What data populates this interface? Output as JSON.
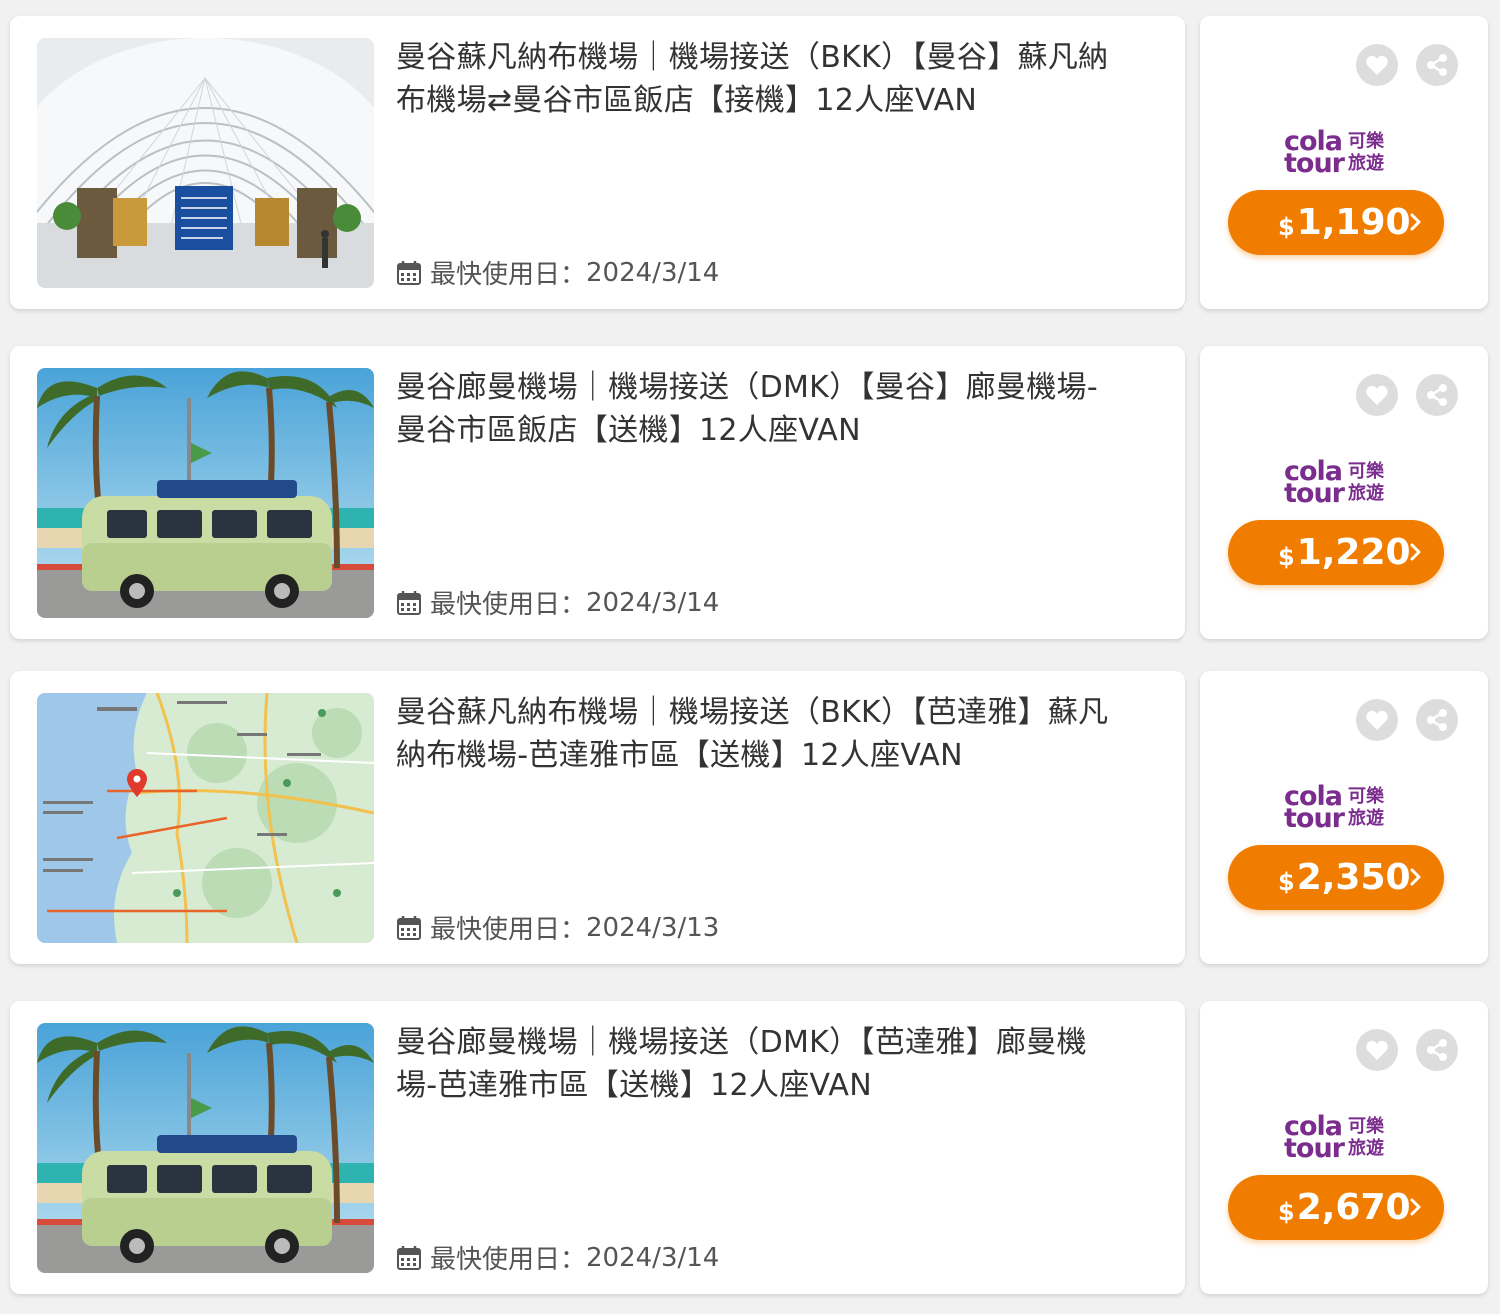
{
  "listings": [
    {
      "title": "曼谷蘇凡納布機場｜機場接送（BKK）【曼谷】蘇凡納布機場⇄曼谷市區飯店【接機】12人座VAN",
      "date_label": "最快使用日：",
      "date": "2024/3/14",
      "brand_en_1": "cola",
      "brand_en_2": "tour",
      "brand_zh_1": "可樂",
      "brand_zh_2": "旅遊",
      "currency": "$",
      "price": "1,190",
      "image_kind": "airport-terminal-photo"
    },
    {
      "title": "曼谷廊曼機場｜機場接送（DMK）【曼谷】廊曼機場-曼谷市區飯店【送機】12人座VAN",
      "date_label": "最快使用日：",
      "date": "2024/3/14",
      "brand_en_1": "cola",
      "brand_en_2": "tour",
      "brand_zh_1": "可樂",
      "brand_zh_2": "旅遊",
      "currency": "$",
      "price": "1,220",
      "image_kind": "beach-van-photo"
    },
    {
      "title": "曼谷蘇凡納布機場｜機場接送（BKK）【芭達雅】蘇凡納布機場-芭達雅市區【送機】12人座VAN",
      "date_label": "最快使用日：",
      "date": "2024/3/13",
      "brand_en_1": "cola",
      "brand_en_2": "tour",
      "brand_zh_1": "可樂",
      "brand_zh_2": "旅遊",
      "currency": "$",
      "price": "2,350",
      "image_kind": "pattaya-map-image"
    },
    {
      "title": "曼谷廊曼機場｜機場接送（DMK）【芭達雅】廊曼機場-芭達雅市區【送機】12人座VAN",
      "date_label": "最快使用日：",
      "date": "2024/3/14",
      "brand_en_1": "cola",
      "brand_en_2": "tour",
      "brand_zh_1": "可樂",
      "brand_zh_2": "旅遊",
      "currency": "$",
      "price": "2,670",
      "image_kind": "beach-van-photo"
    }
  ],
  "colors": {
    "accent_orange": "#f07d00",
    "brand_purple": "#7b2d8e",
    "icon_circle_gray": "#dddddd"
  },
  "icons": {
    "calendar": "calendar-icon",
    "favorite": "heart-icon",
    "share": "share-icon",
    "price_arrow": "chevron-right-icon"
  }
}
